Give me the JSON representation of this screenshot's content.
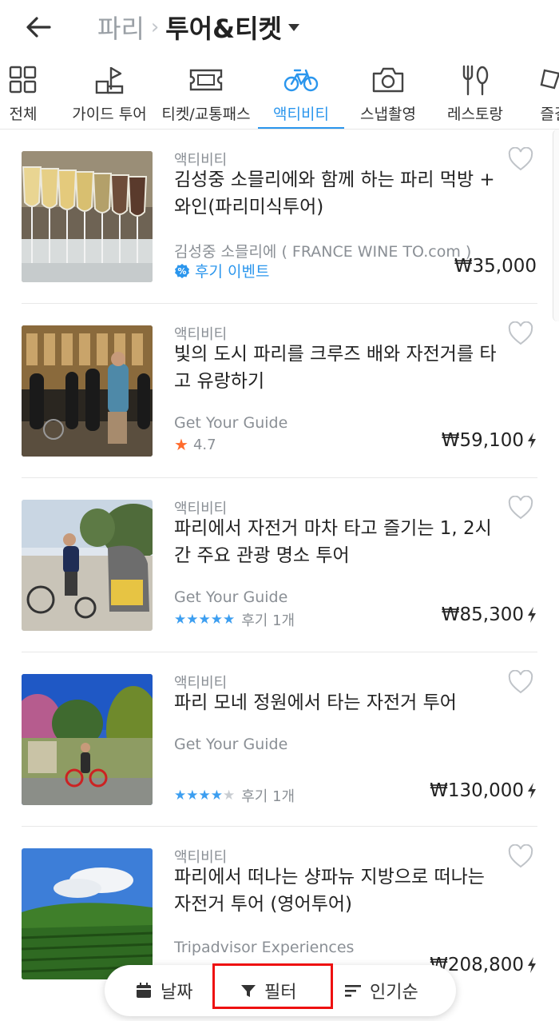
{
  "header": {
    "parent": "파리",
    "current": "투어&티켓"
  },
  "categories": [
    {
      "label": "전체",
      "icon": "grid-icon"
    },
    {
      "label": "가이드 투어",
      "icon": "flag-guide-icon"
    },
    {
      "label": "티켓/교통패스",
      "icon": "ticket-icon"
    },
    {
      "label": "액티비티",
      "icon": "bicycle-icon",
      "active": true
    },
    {
      "label": "스냅촬영",
      "icon": "camera-icon"
    },
    {
      "label": "레스토랑",
      "icon": "cutlery-icon"
    },
    {
      "label": "즐길",
      "icon": "more-icon"
    }
  ],
  "items": [
    {
      "category": "액티비티",
      "title": "김성중 소믈리에와 함께 하는 파리 먹방 + 와인(파리미식투어)",
      "provider": "김성중 소믈리에 ( FRANCE WINE TO.com )",
      "event": "후기 이벤트",
      "price": "₩35,000"
    },
    {
      "category": "액티비티",
      "title": "빛의 도시 파리를 크루즈 배와 자전거를 타고 유랑하기",
      "provider": "Get Your Guide",
      "rating": "4.7",
      "price": "₩59,100"
    },
    {
      "category": "액티비티",
      "title": "파리에서 자전거 마차 타고 즐기는 1, 2시간 주요 관광 명소 투어",
      "provider": "Get Your Guide",
      "stars": 5,
      "reviews": "후기 1개",
      "price": "₩85,300"
    },
    {
      "category": "액티비티",
      "title": "파리 모네 정원에서 타는 자전거 투어",
      "provider": "Get Your Guide",
      "stars": 4,
      "reviews": "후기 1개",
      "price": "₩130,000"
    },
    {
      "category": "액티비티",
      "title": "파리에서 떠나는 샹파뉴 지방으로 떠나는 자전거 투어 (영어투어)",
      "provider": "Tripadvisor Experiences",
      "price": "₩208,800"
    }
  ],
  "bottom_bar": {
    "date": "날짜",
    "filter": "필터",
    "sort": "인기순"
  },
  "colors": {
    "accent": "#2b96ed",
    "highlight": "#ee1111"
  }
}
